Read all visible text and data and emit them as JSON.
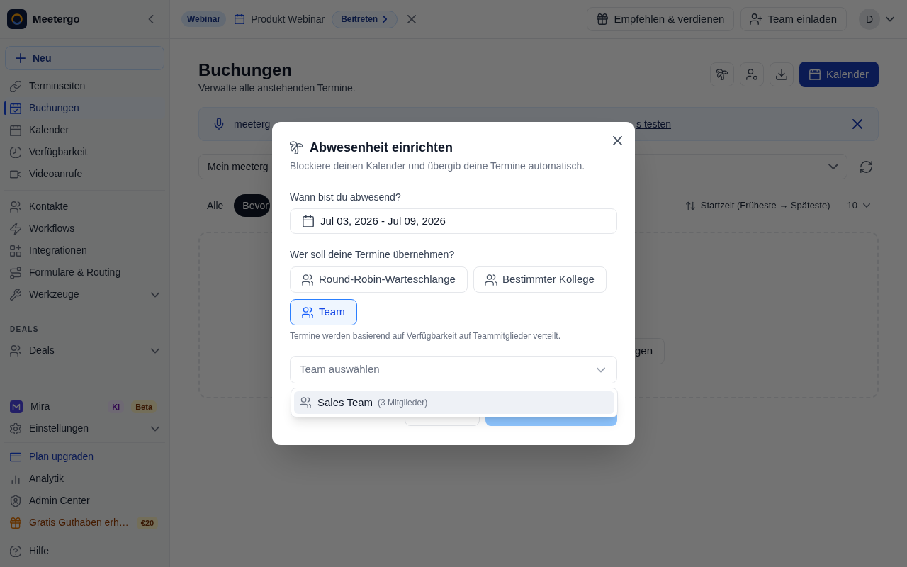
{
  "sidebar": {
    "brand": "Meetergo",
    "new_button": "Neu",
    "nav": [
      {
        "label": "Terminseiten",
        "selected": false
      },
      {
        "label": "Buchungen",
        "selected": true
      },
      {
        "label": "Kalender",
        "selected": false
      },
      {
        "label": "Verfügbarkeit",
        "selected": false
      },
      {
        "label": "Videoanrufe",
        "selected": false
      }
    ],
    "tools": [
      {
        "label": "Kontakte",
        "selected": false
      },
      {
        "label": "Workflows",
        "selected": false
      },
      {
        "label": "Integrationen",
        "selected": false
      },
      {
        "label": "Formulare & Routing",
        "selected": false
      },
      {
        "label": "Werkzeuge",
        "selected": false,
        "expanded": false
      }
    ],
    "deals": {
      "heading": "DEALS",
      "items": [
        {
          "label": "Deals",
          "selected": false,
          "expanded": false
        }
      ]
    },
    "footer_groups": [
      [
        {
          "kind": "assistant",
          "label": "Mira",
          "selected": false,
          "badges": [
            {
              "kind": "ai",
              "text": "KI"
            },
            {
              "kind": "beta",
              "text": "Beta"
            }
          ]
        },
        {
          "kind": "link",
          "label": "Einstellungen",
          "selected": false,
          "expanded": false
        }
      ],
      [
        {
          "kind": "upgrade",
          "label": "Plan upgraden",
          "selected": false
        },
        {
          "kind": "link",
          "label": "Analytik",
          "selected": false
        },
        {
          "kind": "link",
          "label": "Admin Center",
          "selected": false
        },
        {
          "kind": "promo",
          "label": "Gratis Guthaben erh…",
          "selected": false,
          "badges": [
            {
              "kind": "amount",
              "text": "€20"
            }
          ]
        }
      ],
      [
        {
          "kind": "link",
          "label": "Hilfe",
          "selected": false
        }
      ]
    ]
  },
  "topbar": {
    "event_tag": "Webinar",
    "event_title": "Produkt Webinar",
    "join_button": "Beitreten",
    "actions": [
      {
        "kind": "refer",
        "label": "Empfehlen & verdienen"
      },
      {
        "kind": "invite",
        "label": "Team einladen"
      }
    ],
    "avatar_initial": "D"
  },
  "page": {
    "title": "Buchungen",
    "subtitle": "Verwalte alle anstehenden Termine.",
    "calendar_button": "Kalender",
    "banner": {
      "text": "meeterg",
      "link": "s testen"
    },
    "filter": {
      "value": "Mein meeterg"
    },
    "tabs": [
      {
        "label": "Alle",
        "selected": false
      },
      {
        "label": "Bevor",
        "selected": true
      }
    ],
    "sort": "Startzeit (Früheste → Späteste)",
    "page_size": "10",
    "empty_state": {
      "button": "gen"
    }
  },
  "modal": {
    "title": "Abwesenheit einrichten",
    "subtitle": "Blockiere deinen Kalender und übergib deine Termine automatisch.",
    "date_label": "Wann bist du abwesend?",
    "date_range": "Jul 03, 2026 - Jul 09, 2026",
    "assignee_label": "Wer soll deine Termine übernehmen?",
    "options": [
      {
        "label": "Round-Robin-Warteschlange",
        "selected": false
      },
      {
        "label": "Bestimmter Kollege",
        "selected": false
      },
      {
        "label": "Team",
        "selected": true
      }
    ],
    "hint": "Termine werden basierend auf Verfügbarkeit auf Teammitglieder verteilt.",
    "team_select": {
      "placeholder": "Team auswählen",
      "expanded": true,
      "options": [
        {
          "name": "Sales Team",
          "members": "(3 Mitglieder)",
          "highlighted": true
        }
      ]
    },
    "footer_buttons": [
      {
        "kind": "secondary",
        "disabled": false
      },
      {
        "kind": "primary",
        "disabled": true
      }
    ]
  }
}
